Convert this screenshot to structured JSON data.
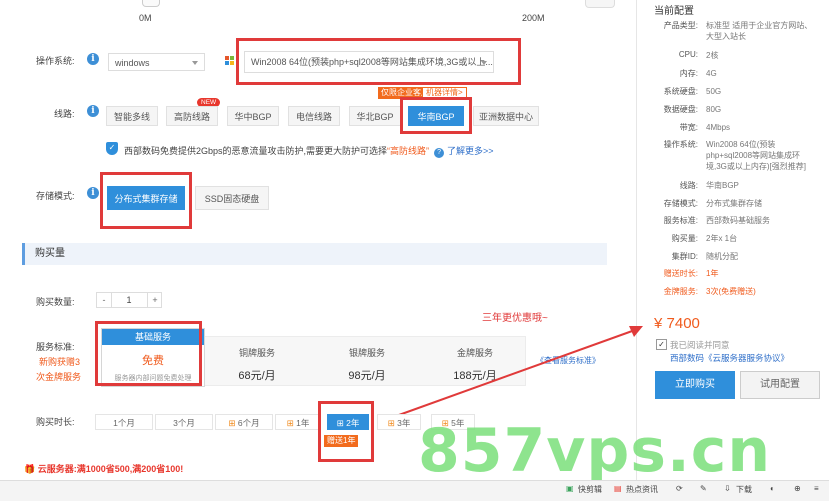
{
  "slider": {
    "min_label": "0M",
    "max_label": "200M"
  },
  "os": {
    "label": "操作系统:",
    "type_value": "windows",
    "image_value": "Win2008 64位(预装php+sql2008等网站集成环境,3G或以上..."
  },
  "line": {
    "label": "线路:",
    "badge_new": "NEW",
    "promo_tag": "仅限企业客户",
    "promo_link": "机器详情>",
    "options": [
      "智能多线",
      "高防线路",
      "华中BGP",
      "电信线路",
      "华北BGP",
      "华南BGP",
      "亚洲数据中心"
    ],
    "selected": "华南BGP",
    "notice_prefix": "西部数码免费提供2Gbps的恶意流量攻击防护,需要更大防护可选择",
    "notice_link": "“高防线路”",
    "notice_more": "了解更多>>"
  },
  "storage": {
    "label": "存储模式:",
    "options": [
      "分布式集群存储",
      "SSD固态硬盘"
    ],
    "selected": "分布式集群存储"
  },
  "purchase": {
    "section_title": "购买量",
    "qty_label": "购买数量:",
    "qty_minus": "-",
    "qty_value": "1",
    "qty_plus": "+"
  },
  "service": {
    "label": "服务标准:",
    "side_note_1": "新购获赠3",
    "side_note_2": "次金牌服务",
    "basic": {
      "title": "基础服务",
      "price": "免费",
      "desc": "服务器内部问题免费处理"
    },
    "tiers": [
      {
        "name": "铜牌服务",
        "price": "68元/月"
      },
      {
        "name": "银牌服务",
        "price": "98元/月"
      },
      {
        "name": "金牌服务",
        "price": "188元/月"
      }
    ],
    "compare_link": "《查看服务标准》"
  },
  "annotation": {
    "text": "三年更优惠哦~"
  },
  "duration": {
    "label": "购买时长:",
    "options": [
      "1个月",
      "3个月",
      "6个月",
      "1年",
      "2年",
      "3年",
      "5年"
    ],
    "selected": "2年",
    "gift_tag": "赠送1年"
  },
  "promo_banner": "云服务器:满1000省500,满200省100!",
  "right_panel": {
    "title": "当前配置",
    "rows": [
      {
        "k": "产品类型:",
        "v": "标准型 适用于企业官方网站、大型入站长"
      },
      {
        "k": "CPU:",
        "v": "2核"
      },
      {
        "k": "内存:",
        "v": "4G"
      },
      {
        "k": "系统硬盘:",
        "v": "50G"
      },
      {
        "k": "数据硬盘:",
        "v": "80G"
      },
      {
        "k": "带宽:",
        "v": "4Mbps"
      },
      {
        "k": "操作系统:",
        "v": "Win2008 64位(预装php+sql2008等网站集成环境,3G或以上内存)[强烈推荐]"
      },
      {
        "k": "线路:",
        "v": "华南BGP"
      },
      {
        "k": "存储模式:",
        "v": "分布式集群存储"
      },
      {
        "k": "服务标准:",
        "v": "西部数码基础服务"
      },
      {
        "k": "购买量:",
        "v": "2年x 1台"
      },
      {
        "k": "集群ID:",
        "v": "随机分配"
      },
      {
        "k": "赠送时长:",
        "v": "1年"
      },
      {
        "k": "金牌服务:",
        "v": "3次(免费赠送)"
      }
    ],
    "price": "¥ 7400",
    "agree_prefix": "我已阅读并同意",
    "agree_link": "西部数码《云服务器服务协议》",
    "buy_button": "立即购买",
    "try_button": "试用配置"
  },
  "watermark": "857vps.cn",
  "taskbar": [
    "快剪辑",
    "热点资讯",
    "下载"
  ],
  "colors": {
    "accent": "#2f8fdb",
    "red_annotation": "#e03a3a",
    "price": "#f05a1c",
    "watermark": "#7be07b"
  }
}
